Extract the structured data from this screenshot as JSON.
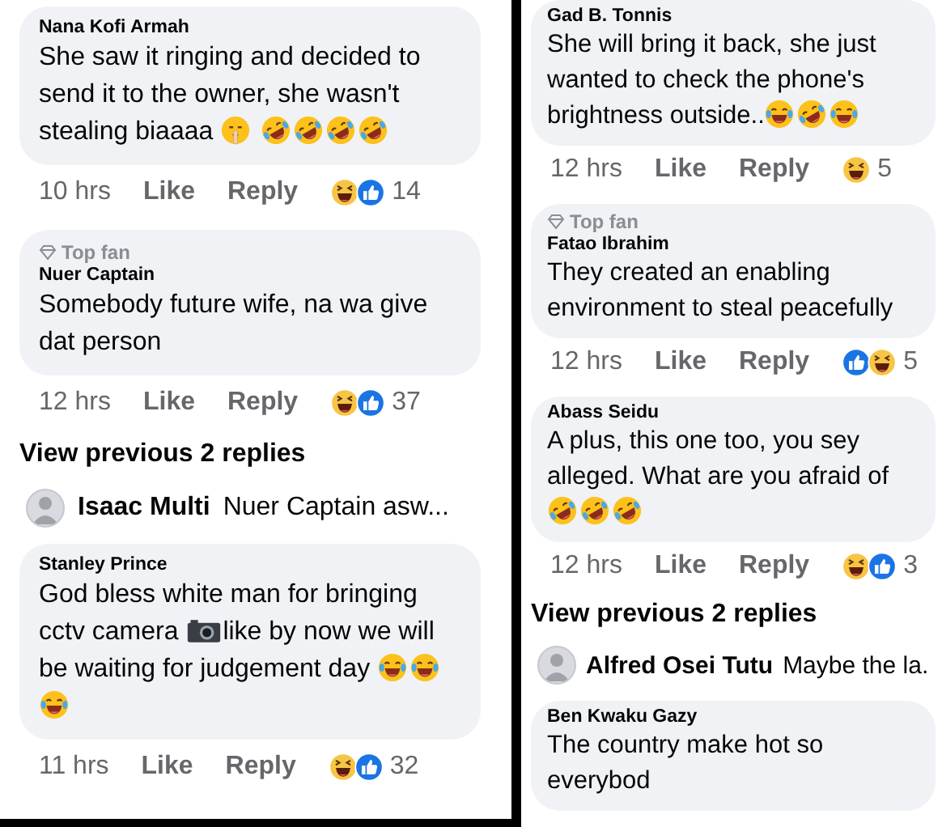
{
  "columns": [
    {
      "items": [
        {
          "kind": "comment",
          "name": "Nana Kofi Armah",
          "body": [
            {
              "kind": "text",
              "text": "She saw it ringing and decided to send it to the owner, she wasn't stealing biaaaa "
            },
            {
              "kind": "shush"
            },
            {
              "kind": "rofl"
            },
            {
              "kind": "rofl"
            },
            {
              "kind": "rofl"
            },
            {
              "kind": "rofl"
            }
          ],
          "time": "10 hrs",
          "actions": [
            "Like",
            "Reply"
          ],
          "reactions": [
            {
              "kind": "haha"
            },
            {
              "kind": "like"
            }
          ],
          "count": "14"
        },
        {
          "kind": "comment",
          "badge": "Top fan",
          "name": "Nuer Captain",
          "body": [
            {
              "kind": "text",
              "text": "Somebody future wife, na wa give dat person"
            }
          ],
          "time": "12 hrs",
          "actions": [
            "Like",
            "Reply"
          ],
          "reactions": [
            {
              "kind": "haha"
            },
            {
              "kind": "like"
            }
          ],
          "count": "37"
        },
        {
          "kind": "more",
          "text": "View previous 2 replies"
        },
        {
          "kind": "reply",
          "author": "Isaac Multi",
          "text": "Nuer Captain asw..."
        },
        {
          "kind": "comment",
          "name": "Stanley Prince",
          "body": [
            {
              "kind": "text",
              "text": "God bless white man for bringing cctv camera "
            },
            {
              "kind": "camera"
            },
            {
              "kind": "text",
              "text": "like by now we will be waiting for judgement day "
            },
            {
              "kind": "joy"
            },
            {
              "kind": "joy"
            },
            {
              "kind": "joy"
            }
          ],
          "time": "11 hrs",
          "actions": [
            "Like",
            "Reply"
          ],
          "reactions": [
            {
              "kind": "haha"
            },
            {
              "kind": "like"
            }
          ],
          "count": "32"
        }
      ]
    },
    {
      "items": [
        {
          "kind": "comment",
          "name": "Gad B. Tonnis",
          "body": [
            {
              "kind": "text",
              "text": "She will bring it back, she just wanted to check the phone's brightness outside.."
            },
            {
              "kind": "joy"
            },
            {
              "kind": "rofl"
            },
            {
              "kind": "joy"
            }
          ],
          "time": "12 hrs",
          "actions": [
            "Like",
            "Reply"
          ],
          "reactions": [
            {
              "kind": "haha"
            }
          ],
          "count": "5"
        },
        {
          "kind": "comment",
          "badge": "Top fan",
          "name": "Fatao Ibrahim",
          "body": [
            {
              "kind": "text",
              "text": "They created an enabling environment to steal peacefully"
            }
          ],
          "time": "12 hrs",
          "actions": [
            "Like",
            "Reply"
          ],
          "reactions": [
            {
              "kind": "like"
            },
            {
              "kind": "haha"
            }
          ],
          "count": "5"
        },
        {
          "kind": "comment",
          "name": "Abass Seidu",
          "body": [
            {
              "kind": "text",
              "text": "A plus, this one too, you sey alleged. What are you afraid of "
            },
            {
              "kind": "rofl"
            },
            {
              "kind": "rofl"
            },
            {
              "kind": "rofl"
            }
          ],
          "time": "12 hrs",
          "actions": [
            "Like",
            "Reply"
          ],
          "reactions": [
            {
              "kind": "haha"
            },
            {
              "kind": "like"
            }
          ],
          "count": "3"
        },
        {
          "kind": "more",
          "text": "View previous 2 replies"
        },
        {
          "kind": "reply",
          "author": "Alfred Osei Tutu",
          "text": "Maybe the la."
        },
        {
          "kind": "comment",
          "name": "Ben Kwaku Gazy",
          "body": [
            {
              "kind": "text",
              "text": "The country make hot so everybod"
            }
          ]
        }
      ]
    }
  ]
}
